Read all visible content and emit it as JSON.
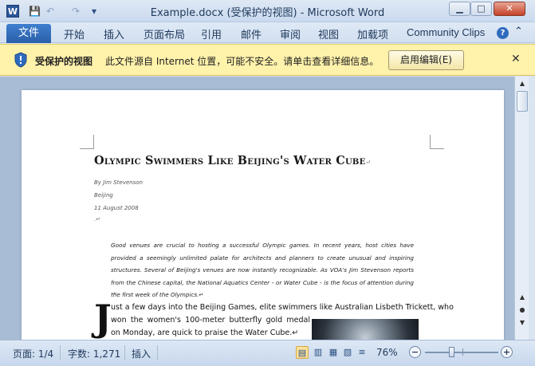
{
  "window": {
    "title": "Example.docx (受保护的视图) - Microsoft Word",
    "app_icon": "W",
    "minimize": "▁",
    "maximize": "□",
    "close": "✕"
  },
  "qat": {
    "save": "💾",
    "undo": "↶",
    "redo": "↷",
    "customize": "▾"
  },
  "ribbon": {
    "file": "文件",
    "tabs": [
      "开始",
      "插入",
      "页面布局",
      "引用",
      "邮件",
      "审阅",
      "视图",
      "加载项",
      "Community Clips"
    ],
    "collapse": "⌃",
    "help": "?"
  },
  "protected_view": {
    "title": "受保护的视图",
    "message": "此文件源自 Internet 位置，可能不安全。请单击查看详细信息。",
    "enable_button": "启用编辑(E)",
    "close": "✕"
  },
  "document": {
    "title": "Olympic Swimmers Like Beijing's Water Cube",
    "return_mark": "↵",
    "author": "By Jim Stevenson",
    "location": "Beijing",
    "date": "11 August 2008",
    "blank_mark": ".↵",
    "abstract": "Good venues are crucial to hosting a successful Olympic games. In recent years, host cities have provided a seemingly unlimited palate for architects and planners to create unusual and inspiring structures. Several of Beijing's venues are now instantly recognizable. As VOA's Jim Stevenson reports from the Chinese capital, the National Aquatics Center - or Water Cube - is the focus of attention during the first week of the Olympics.↵",
    "blank_mark2": ".↵",
    "dropcap": "J",
    "body_line1": "ust a few days into the Beijing Games, elite swimmers like Australian Lisbeth Trickett, who",
    "body_rest": "won the women's 100-meter butterfly gold medal on Monday, are quick to praise the Water Cube.↵"
  },
  "status": {
    "page": "页面: 1/4",
    "words": "字数: 1,271",
    "mode": "插入",
    "zoom": "76%",
    "zoom_level": 0.76,
    "zoom_minus": "−",
    "zoom_plus": "+"
  }
}
